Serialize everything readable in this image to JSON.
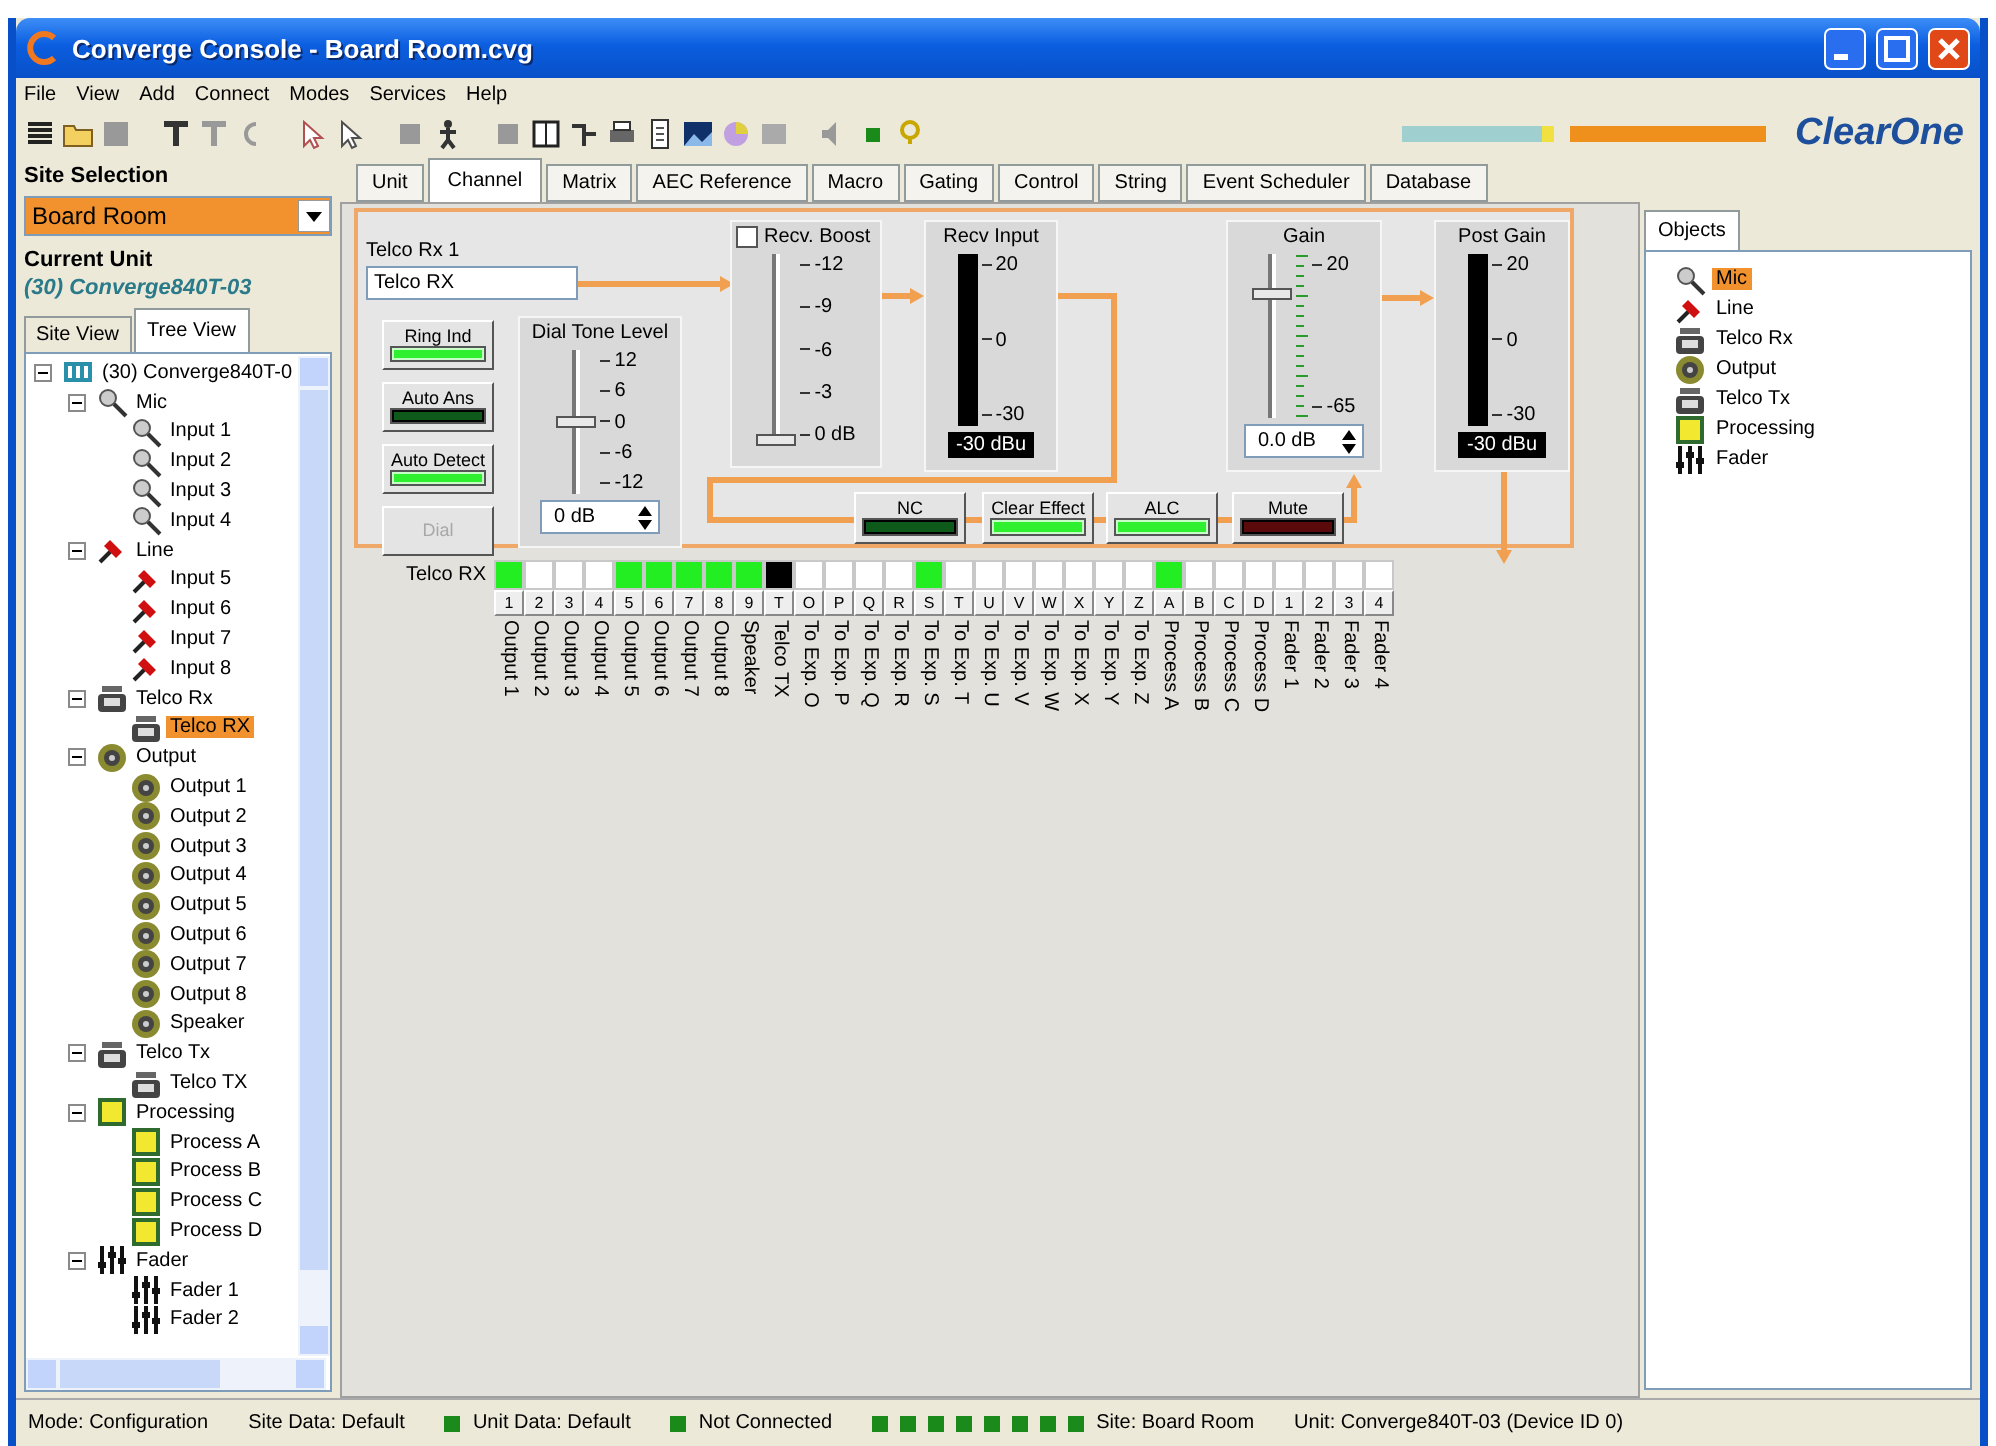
{
  "window": {
    "title": "Converge Console - Board Room.cvg"
  },
  "menu": [
    "File",
    "View",
    "Add",
    "Connect",
    "Modes",
    "Services",
    "Help"
  ],
  "logo": {
    "text": "ClearOne"
  },
  "sidebar": {
    "site_label": "Site Selection",
    "site_value": "Board Room",
    "unit_label": "Current Unit",
    "unit_value": "(30) Converge840T-03",
    "tabs": [
      {
        "label": "Site View",
        "selected": false
      },
      {
        "label": "Tree View",
        "selected": true
      }
    ],
    "tree": {
      "label": "(30) Converge840T-0",
      "kind": "unit",
      "expanded": true,
      "selected": false,
      "children": [
        {
          "label": "Mic",
          "kind": "mic",
          "expanded": true,
          "selected": false,
          "children": [
            {
              "label": "Input 1",
              "kind": "mic",
              "selected": false
            },
            {
              "label": "Input 2",
              "kind": "mic",
              "selected": false
            },
            {
              "label": "Input 3",
              "kind": "mic",
              "selected": false
            },
            {
              "label": "Input 4",
              "kind": "mic",
              "selected": false
            }
          ]
        },
        {
          "label": "Line",
          "kind": "line",
          "expanded": true,
          "selected": false,
          "children": [
            {
              "label": "Input 5",
              "kind": "line",
              "selected": false
            },
            {
              "label": "Input 6",
              "kind": "line",
              "selected": false
            },
            {
              "label": "Input 7",
              "kind": "line",
              "selected": false
            },
            {
              "label": "Input 8",
              "kind": "line",
              "selected": false
            }
          ]
        },
        {
          "label": "Telco Rx",
          "kind": "telco_rx",
          "expanded": true,
          "selected": false,
          "children": [
            {
              "label": "Telco RX",
              "kind": "telco_rx",
              "selected": true
            }
          ]
        },
        {
          "label": "Output",
          "kind": "output",
          "expanded": true,
          "selected": false,
          "children": [
            {
              "label": "Output 1",
              "kind": "output",
              "selected": false
            },
            {
              "label": "Output 2",
              "kind": "output",
              "selected": false
            },
            {
              "label": "Output 3",
              "kind": "output",
              "selected": false
            },
            {
              "label": "Output 4",
              "kind": "output",
              "selected": false
            },
            {
              "label": "Output 5",
              "kind": "output",
              "selected": false
            },
            {
              "label": "Output 6",
              "kind": "output",
              "selected": false
            },
            {
              "label": "Output 7",
              "kind": "output",
              "selected": false
            },
            {
              "label": "Output 8",
              "kind": "output",
              "selected": false
            },
            {
              "label": "Speaker",
              "kind": "output",
              "selected": false
            }
          ]
        },
        {
          "label": "Telco Tx",
          "kind": "telco_tx",
          "expanded": true,
          "selected": false,
          "children": [
            {
              "label": "Telco TX",
              "kind": "telco_tx",
              "selected": false
            }
          ]
        },
        {
          "label": "Processing",
          "kind": "processing",
          "expanded": true,
          "selected": false,
          "children": [
            {
              "label": "Process A",
              "kind": "processing",
              "selected": false
            },
            {
              "label": "Process B",
              "kind": "processing",
              "selected": false
            },
            {
              "label": "Process C",
              "kind": "processing",
              "selected": false
            },
            {
              "label": "Process D",
              "kind": "processing",
              "selected": false
            }
          ]
        },
        {
          "label": "Fader",
          "kind": "fader",
          "expanded": true,
          "selected": false,
          "children": [
            {
              "label": "Fader 1",
              "kind": "fader",
              "selected": false
            },
            {
              "label": "Fader 2",
              "kind": "fader",
              "selected": false
            }
          ]
        }
      ]
    }
  },
  "tabs": [
    {
      "label": "Unit",
      "selected": false
    },
    {
      "label": "Channel",
      "selected": true
    },
    {
      "label": "Matrix",
      "selected": false
    },
    {
      "label": "AEC Reference",
      "selected": false
    },
    {
      "label": "Macro",
      "selected": false
    },
    {
      "label": "Gating",
      "selected": false
    },
    {
      "label": "Control",
      "selected": false
    },
    {
      "label": "String",
      "selected": false
    },
    {
      "label": "Event Scheduler",
      "selected": false
    },
    {
      "label": "Database",
      "selected": false
    }
  ],
  "channel": {
    "name_label": "Telco Rx 1",
    "name_value": "Telco RX",
    "side_buttons": [
      {
        "label": "Ring Ind",
        "kind": "led",
        "on": true,
        "disabled": false
      },
      {
        "label": "Auto Ans",
        "kind": "led",
        "on": false,
        "disabled": false
      },
      {
        "label": "Auto Detect",
        "kind": "led",
        "on": true,
        "disabled": false
      },
      {
        "label": "Dial",
        "kind": "plain",
        "disabled": true
      }
    ],
    "dial_tone": {
      "title": "Dial Tone Level",
      "scale": [
        "12",
        "6",
        "0",
        "-6",
        "-12"
      ],
      "level": 0.5,
      "value": "0 dB"
    },
    "recv_boost": {
      "label": "Recv. Boost",
      "checked": false,
      "scale": [
        "-12",
        "-9",
        "-6",
        "-3",
        "0 dB"
      ],
      "level": 0
    },
    "recv_input": {
      "title": "Recv Input",
      "scale": [
        "20",
        "0",
        "-30"
      ],
      "level": 0,
      "reading": "-30 dBu"
    },
    "gain": {
      "title": "Gain",
      "scale": [
        "20",
        "-65"
      ],
      "level": 0.77,
      "value": "0.0 dB"
    },
    "post_gain": {
      "title": "Post Gain",
      "scale": [
        "20",
        "0",
        "-30"
      ],
      "level": 0,
      "reading": "-30 dBu"
    },
    "bottom_buttons": [
      {
        "label": "NC",
        "kind": "led",
        "on": false
      },
      {
        "label": "Clear Effect",
        "kind": "led",
        "on": true
      },
      {
        "label": "ALC",
        "kind": "led",
        "on": true
      },
      {
        "label": "Mute",
        "kind": "mute",
        "on": false
      }
    ]
  },
  "matrix": {
    "row_label": "Telco RX",
    "columns": [
      {
        "number": "1",
        "label": "Output 1",
        "on": true,
        "disabled": false
      },
      {
        "number": "2",
        "label": "Output 2",
        "on": false,
        "disabled": false
      },
      {
        "number": "3",
        "label": "Output 3",
        "on": false,
        "disabled": false
      },
      {
        "number": "4",
        "label": "Output 4",
        "on": false,
        "disabled": false
      },
      {
        "number": "5",
        "label": "Output 5",
        "on": true,
        "disabled": false
      },
      {
        "number": "6",
        "label": "Output 6",
        "on": true,
        "disabled": false
      },
      {
        "number": "7",
        "label": "Output 7",
        "on": true,
        "disabled": false
      },
      {
        "number": "8",
        "label": "Output 8",
        "on": true,
        "disabled": false
      },
      {
        "number": "9",
        "label": "Speaker",
        "on": true,
        "disabled": false
      },
      {
        "number": "T",
        "label": "Telco TX",
        "on": false,
        "disabled": true
      },
      {
        "number": "O",
        "label": "To Exp. O",
        "on": false,
        "disabled": false
      },
      {
        "number": "P",
        "label": "To Exp. P",
        "on": false,
        "disabled": false
      },
      {
        "number": "Q",
        "label": "To Exp. Q",
        "on": false,
        "disabled": false
      },
      {
        "number": "R",
        "label": "To Exp. R",
        "on": false,
        "disabled": false
      },
      {
        "number": "S",
        "label": "To Exp. S",
        "on": true,
        "disabled": false
      },
      {
        "number": "T",
        "label": "To Exp. T",
        "on": false,
        "disabled": false
      },
      {
        "number": "U",
        "label": "To Exp. U",
        "on": false,
        "disabled": false
      },
      {
        "number": "V",
        "label": "To Exp. V",
        "on": false,
        "disabled": false
      },
      {
        "number": "W",
        "label": "To Exp. W",
        "on": false,
        "disabled": false
      },
      {
        "number": "X",
        "label": "To Exp. X",
        "on": false,
        "disabled": false
      },
      {
        "number": "Y",
        "label": "To Exp. Y",
        "on": false,
        "disabled": false
      },
      {
        "number": "Z",
        "label": "To Exp. Z",
        "on": false,
        "disabled": false
      },
      {
        "number": "A",
        "label": "Process A",
        "on": true,
        "disabled": false
      },
      {
        "number": "B",
        "label": "Process B",
        "on": false,
        "disabled": false
      },
      {
        "number": "C",
        "label": "Process C",
        "on": false,
        "disabled": false
      },
      {
        "number": "D",
        "label": "Process D",
        "on": false,
        "disabled": false
      },
      {
        "number": "1",
        "label": "Fader 1",
        "on": false,
        "disabled": false
      },
      {
        "number": "2",
        "label": "Fader 2",
        "on": false,
        "disabled": false
      },
      {
        "number": "3",
        "label": "Fader 3",
        "on": false,
        "disabled": false
      },
      {
        "number": "4",
        "label": "Fader 4",
        "on": false,
        "disabled": false
      }
    ]
  },
  "objects": {
    "tab": "Objects",
    "items": [
      {
        "label": "Mic",
        "kind": "mic",
        "selected": true
      },
      {
        "label": "Line",
        "kind": "line",
        "selected": false
      },
      {
        "label": "Telco Rx",
        "kind": "telco_rx",
        "selected": false
      },
      {
        "label": "Output",
        "kind": "output",
        "selected": false
      },
      {
        "label": "Telco Tx",
        "kind": "telco_tx",
        "selected": false
      },
      {
        "label": "Processing",
        "kind": "processing",
        "selected": false
      },
      {
        "label": "Fader",
        "kind": "fader",
        "selected": false
      }
    ]
  },
  "status_bar": {
    "items": [
      {
        "kind": "text",
        "text": "Mode: Configuration"
      },
      {
        "kind": "text",
        "text": "Site Data: Default"
      },
      {
        "kind": "led"
      },
      {
        "kind": "text",
        "text": "Unit Data: Default"
      },
      {
        "kind": "led"
      },
      {
        "kind": "text",
        "text": "Not Connected"
      },
      {
        "kind": "led"
      },
      {
        "kind": "led"
      },
      {
        "kind": "led"
      },
      {
        "kind": "led"
      },
      {
        "kind": "led"
      },
      {
        "kind": "led"
      },
      {
        "kind": "led"
      },
      {
        "kind": "led"
      },
      {
        "kind": "text",
        "text": "Site: Board Room"
      },
      {
        "kind": "text",
        "text": "Unit: Converge840T-03 (Device ID 0)"
      }
    ]
  }
}
